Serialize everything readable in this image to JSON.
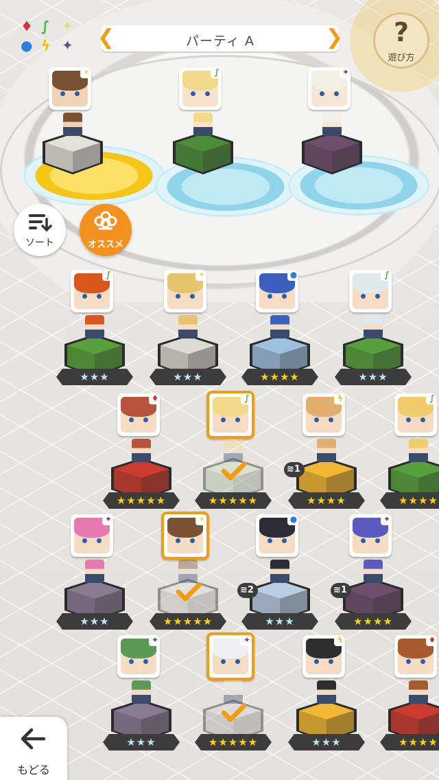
{
  "header": {
    "party_title": "パーティ A",
    "prev_icon": "chevron-left-icon",
    "next_icon": "chevron-right-icon",
    "element_legend": [
      {
        "name": "fire-element-icon",
        "symbol": "♦",
        "color": "#d9303b"
      },
      {
        "name": "wind-element-icon",
        "symbol": "∫",
        "color": "#3bbb3b"
      },
      {
        "name": "light-element-icon",
        "symbol": "✦",
        "color": "#e8e06a"
      },
      {
        "name": "water-element-icon",
        "symbol": "●",
        "color": "#2b7de0"
      },
      {
        "name": "thunder-element-icon",
        "symbol": "ϟ",
        "color": "#f2c200"
      },
      {
        "name": "dark-element-icon",
        "symbol": "✦",
        "color": "#6a4a8a"
      }
    ]
  },
  "help": {
    "icon": "?",
    "label": "遊び方"
  },
  "left_buttons": {
    "sort_label": "ソート",
    "recommend_label": "オススメ"
  },
  "footer": {
    "back_label": "もどる"
  },
  "party_slots": [
    {
      "element": "light",
      "hair": "#7a5233",
      "skin": "#f2d3b5",
      "pedestal": "#e4e1da",
      "stars": ""
    },
    {
      "element": "wind",
      "hair": "#f3d98a",
      "skin": "#f9e2cc",
      "pedestal": "#4c8d38",
      "stars": ""
    },
    {
      "element": "dark",
      "hair": "#f0f0e6",
      "skin": "#f7e6d6",
      "pedestal": "#6e4e6a",
      "stars": ""
    }
  ],
  "roster": [
    {
      "id": "r1",
      "element": "wind",
      "hair": "#d9571f",
      "pedestal": "#58a03c",
      "stars": "★★★",
      "tier": "silver",
      "selected": false,
      "stack": ""
    },
    {
      "id": "r2",
      "element": "light",
      "hair": "#e8c46e",
      "pedestal": "#dcdad4",
      "stars": "★★★",
      "tier": "silver",
      "selected": false,
      "stack": ""
    },
    {
      "id": "r3",
      "element": "water",
      "hair": "#3c5fbf",
      "pedestal": "#9dbfe0",
      "stars": "★★★★",
      "tier": "gold",
      "selected": false,
      "stack": ""
    },
    {
      "id": "r4",
      "element": "wind",
      "hair": "#dfe8ea",
      "pedestal": "#58a03c",
      "stars": "★★★",
      "tier": "silver",
      "selected": false,
      "stack": ""
    },
    {
      "id": "r5",
      "element": "fire",
      "hair": "#b8523c",
      "pedestal": "#cc3b2f",
      "stars": "★★★★★",
      "tier": "gold",
      "selected": false,
      "stack": ""
    },
    {
      "id": "r6",
      "element": "wind",
      "hair": "#f3d98a",
      "pedestal": "#cfe0c4",
      "stars": "★★★★★",
      "tier": "gold",
      "selected": true,
      "stack": ""
    },
    {
      "id": "r7",
      "element": "thunder",
      "hair": "#e2b06e",
      "pedestal": "#f2b732",
      "stars": "★★★★",
      "tier": "gold",
      "selected": false,
      "stack": "1"
    },
    {
      "id": "r8",
      "element": "wind",
      "hair": "#f0cc6a",
      "pedestal": "#58a03c",
      "stars": "★★★★",
      "tier": "gold",
      "selected": false,
      "stack": ""
    },
    {
      "id": "r9",
      "element": "dark",
      "hair": "#e67ab0",
      "pedestal": "#8a7a92",
      "stars": "★★★",
      "tier": "silver",
      "selected": false,
      "stack": ""
    },
    {
      "id": "r10",
      "element": "light",
      "hair": "#7a5233",
      "pedestal": "#e2dfd8",
      "stars": "★★★★★",
      "tier": "gold",
      "selected": true,
      "stack": ""
    },
    {
      "id": "r11",
      "element": "water",
      "hair": "#2c2c38",
      "pedestal": "#b8cde4",
      "stars": "★★★",
      "tier": "silver",
      "selected": false,
      "stack": "2"
    },
    {
      "id": "r12",
      "element": "dark",
      "hair": "#5a5abf",
      "pedestal": "#6e4e6a",
      "stars": "★★★★",
      "tier": "gold",
      "selected": false,
      "stack": "1"
    },
    {
      "id": "r13",
      "element": "dark",
      "hair": "#5a9a55",
      "pedestal": "#8a7a92",
      "stars": "★★★",
      "tier": "silver",
      "selected": false,
      "stack": ""
    },
    {
      "id": "r14",
      "element": "dark",
      "hair": "#f0f0f4",
      "pedestal": "#d6d4d6",
      "stars": "★★★★★",
      "tier": "gold",
      "selected": true,
      "stack": ""
    },
    {
      "id": "r15",
      "element": "thunder",
      "hair": "#2e2e2e",
      "pedestal": "#f2b732",
      "stars": "★★★",
      "tier": "silver",
      "selected": false,
      "stack": ""
    },
    {
      "id": "r16",
      "element": "fire",
      "hair": "#a65a2e",
      "pedestal": "#cc3b2f",
      "stars": "★★★★",
      "tier": "gold",
      "selected": false,
      "stack": ""
    }
  ]
}
